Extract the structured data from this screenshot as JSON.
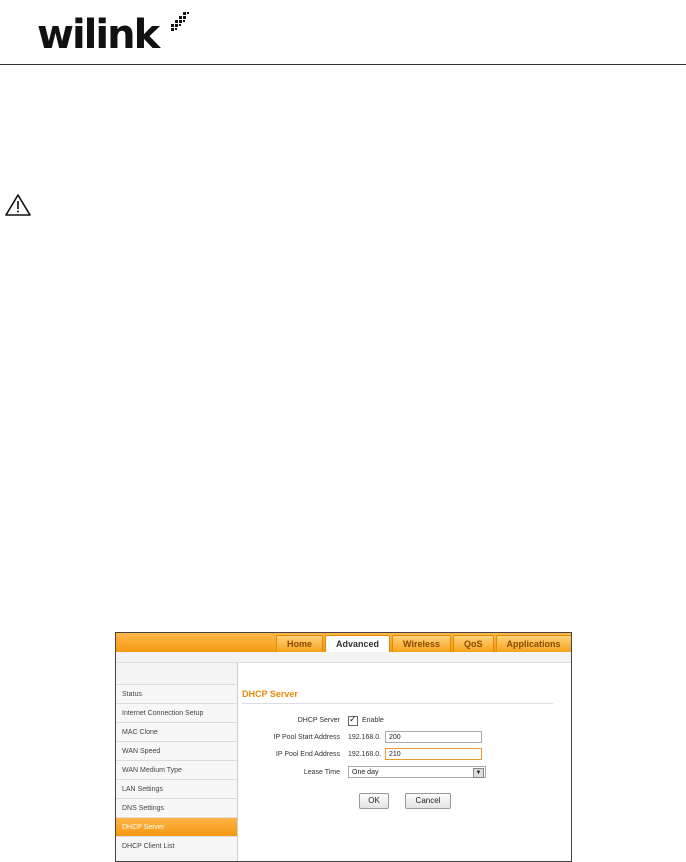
{
  "logo": {
    "text": "wilink"
  },
  "nav": {
    "tabs": [
      {
        "label": "Home",
        "active": false
      },
      {
        "label": "Advanced",
        "active": true
      },
      {
        "label": "Wireless",
        "active": false
      },
      {
        "label": "QoS",
        "active": false
      },
      {
        "label": "Applications",
        "active": false
      }
    ]
  },
  "sidebar": {
    "items": [
      {
        "label": "Status",
        "active": false
      },
      {
        "label": "Internet Connection Setup",
        "active": false
      },
      {
        "label": "MAC Clone",
        "active": false
      },
      {
        "label": "WAN Speed",
        "active": false
      },
      {
        "label": "WAN Medium Type",
        "active": false
      },
      {
        "label": "LAN Settings",
        "active": false
      },
      {
        "label": "DNS Settings",
        "active": false
      },
      {
        "label": "DHCP Server",
        "active": true
      },
      {
        "label": "DHCP Client List",
        "active": false
      }
    ]
  },
  "form": {
    "title": "DHCP Server",
    "dhcp_server_label": "DHCP Server",
    "enable_label": "Enable",
    "enable_checked": true,
    "start_label": "IP Pool Start Address",
    "start_prefix": "192.168.0.",
    "start_value": "200",
    "end_label": "IP Pool End Address",
    "end_prefix": "192.168.0.",
    "end_value": "210",
    "lease_label": "Lease Time",
    "lease_value": "One day",
    "ok_label": "OK",
    "cancel_label": "Cancel"
  },
  "colors": {
    "accent": "#f39a12",
    "title": "#e8890c"
  }
}
